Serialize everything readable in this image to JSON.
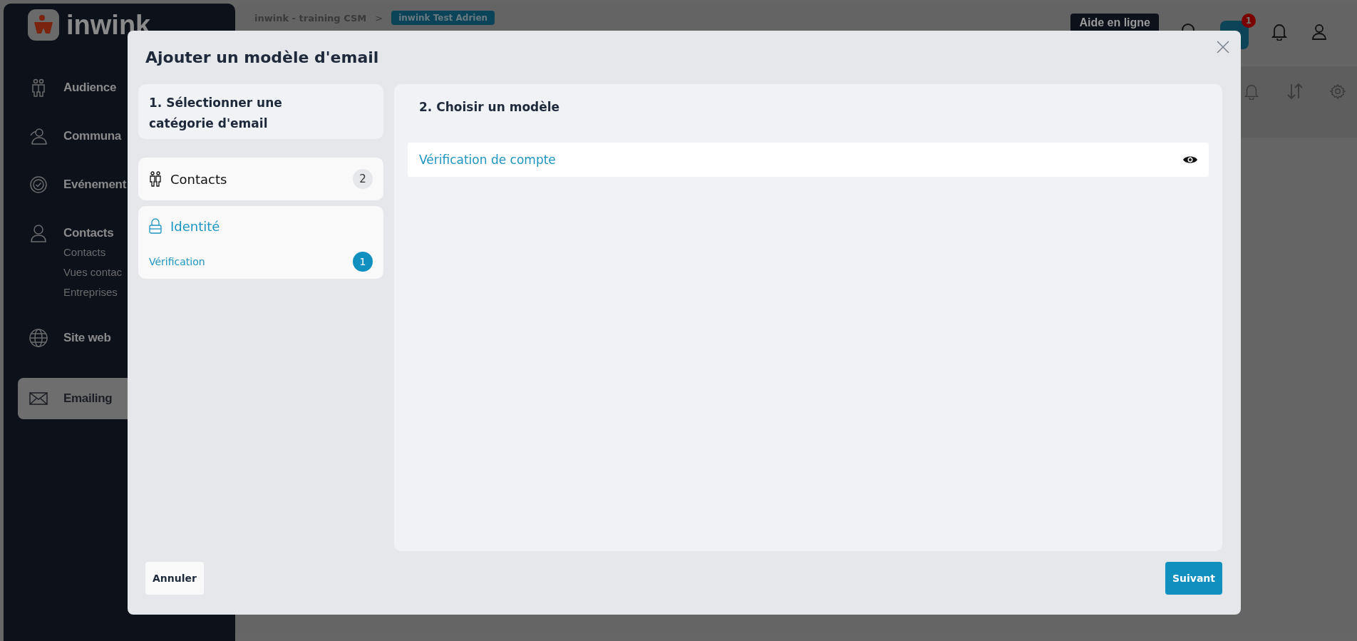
{
  "sidebar": {
    "logo": "inwink",
    "items": [
      {
        "label": "Audience",
        "selected": false
      },
      {
        "label": "Communa",
        "selected": false
      },
      {
        "label": "Evénement",
        "selected": false
      },
      {
        "label": "Contacts",
        "selected": false,
        "children": [
          "Contacts",
          "Vues contac",
          "Entreprises"
        ]
      },
      {
        "label": "Site web",
        "selected": false
      },
      {
        "label": "Emailing",
        "selected": true
      }
    ]
  },
  "header": {
    "breadcrumb": [
      "inwink - training CSM",
      "inwink Test Adrien"
    ],
    "separator": ">",
    "help_button": "Aide en ligne",
    "notification_badge": "1"
  },
  "modal": {
    "title": "Ajouter un modèle d'email",
    "step1": {
      "heading": "1. Sélectionner une catégorie d'email",
      "categories": [
        {
          "name": "Contacts",
          "count": "2",
          "selected": false
        },
        {
          "name": "Identité",
          "selected": true,
          "items": [
            {
              "label": "Vérification",
              "count": "1",
              "selected": true
            }
          ]
        }
      ]
    },
    "step2": {
      "heading": "2. Choisir un modèle",
      "templates": [
        {
          "label": "Vérification de compte"
        }
      ]
    },
    "buttons": {
      "cancel": "Annuler",
      "next": "Suivant"
    }
  }
}
